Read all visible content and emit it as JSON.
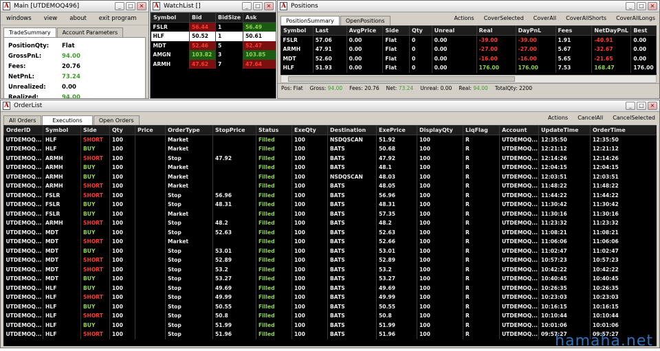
{
  "main": {
    "title": "Main [UTDEMOQ496]",
    "menu": [
      "windows",
      "view",
      "about",
      "exit program"
    ],
    "tabs": [
      "TradeSummary",
      "Account Parameters"
    ],
    "summary": [
      {
        "label": "PositionQty:",
        "value": "Flat",
        "color": "#000000"
      },
      {
        "label": "GrossPnL:",
        "value": "94.00",
        "color": "#3d9d2b"
      },
      {
        "label": "Fees:",
        "value": "20.76",
        "color": "#000000"
      },
      {
        "label": "NetPnL:",
        "value": "73.24",
        "color": "#3d9d2b"
      },
      {
        "label": "Unrealized:",
        "value": "0.00",
        "color": "#000000"
      },
      {
        "label": "Realized:",
        "value": "94.00",
        "color": "#3d9d2b"
      }
    ]
  },
  "watchlist": {
    "title": "WatchList []",
    "headers": [
      "Symbol",
      "Bid",
      "BidSize",
      "Ask"
    ],
    "rows": [
      {
        "symbol": "FSLR",
        "bid": "56.44",
        "bidsize": "1",
        "ask": "56.49",
        "bidc": "red",
        "askc": "grn"
      },
      {
        "symbol": "HLF",
        "bid": "50.52",
        "bidsize": "1",
        "ask": "50.61",
        "bidc": "",
        "askc": "",
        "selected": true
      },
      {
        "symbol": "MDT",
        "bid": "52.46",
        "bidsize": "5",
        "ask": "52.47",
        "bidc": "red",
        "askc": "red"
      },
      {
        "symbol": "AMGN",
        "bid": "103.82",
        "bidsize": "3",
        "ask": "103.85",
        "bidc": "grn",
        "askc": "grn"
      },
      {
        "symbol": "ARMH",
        "bid": "47.62",
        "bidsize": "7",
        "ask": "47.64",
        "bidc": "red",
        "askc": "red"
      }
    ]
  },
  "positions": {
    "title": "Positions",
    "tabs": [
      "PositionSummary",
      "OpenPositions"
    ],
    "actions": [
      "Actions",
      "CoverSelected",
      "CoverAll",
      "CoverAllShorts",
      "CoverAllLongs"
    ],
    "headers": [
      "Symbol",
      "Last",
      "AvgPrice",
      "Side",
      "Qty",
      "Unreal",
      "Real",
      "DayPnL",
      "Fees",
      "NetDayPnL",
      "Best"
    ],
    "rows": [
      {
        "c": [
          "FSLR",
          "57.06",
          "0.00",
          "Flat",
          "0",
          "0.00",
          "-39.00",
          "-39.00",
          "1.91",
          "-40.91",
          "0.00"
        ],
        "cls": [
          "",
          "",
          "",
          "",
          "",
          "",
          "red",
          "red",
          "",
          "red",
          ""
        ]
      },
      {
        "c": [
          "ARMH",
          "47.91",
          "0.00",
          "Flat",
          "0",
          "0.00",
          "-27.00",
          "-27.00",
          "5.67",
          "-32.67",
          "0.00"
        ],
        "cls": [
          "",
          "",
          "",
          "",
          "",
          "",
          "red",
          "red",
          "",
          "red",
          ""
        ]
      },
      {
        "c": [
          "MDT",
          "52.60",
          "0.00",
          "Flat",
          "0",
          "0.00",
          "-16.00",
          "-16.00",
          "5.65",
          "-21.65",
          "0.00"
        ],
        "cls": [
          "",
          "",
          "",
          "",
          "",
          "",
          "red",
          "red",
          "",
          "red",
          ""
        ]
      },
      {
        "c": [
          "HLF",
          "51.93",
          "0.00",
          "Flat",
          "0",
          "0.00",
          "176.00",
          "176.00",
          "7.53",
          "168.47",
          "176.00"
        ],
        "cls": [
          "",
          "",
          "",
          "",
          "",
          "",
          "grn",
          "grn",
          "",
          "grn",
          ""
        ]
      }
    ],
    "footer": [
      {
        "k": "Pos:",
        "v": "Flat",
        "c": "#000000"
      },
      {
        "k": "Gross:",
        "v": "94.00",
        "c": "#3d9d2b"
      },
      {
        "k": "Fees:",
        "v": "20.76",
        "c": "#000000"
      },
      {
        "k": "Net:",
        "v": "73.24",
        "c": "#3d9d2b"
      },
      {
        "k": "Unreal:",
        "v": "0.00",
        "c": "#000000"
      },
      {
        "k": "Real:",
        "v": "94.00",
        "c": "#3d9d2b"
      },
      {
        "k": "TotalQty:",
        "v": "2200",
        "c": "#000000"
      }
    ]
  },
  "orderlist": {
    "title": "OrderList",
    "tabs": [
      "All Orders",
      "Executions",
      "Open Orders"
    ],
    "actions": [
      "Actions",
      "CancelAll",
      "CancelSelected"
    ],
    "headers": [
      "OrderID",
      "Symbol",
      "Side",
      "Qty",
      "Price",
      "OrderType",
      "StopPrice",
      "Status",
      "ExeQty",
      "Destination",
      "ExePrice",
      "DisplayQty",
      "LiqFlag",
      "Account",
      "UpdateTime",
      "OrderTime"
    ],
    "rows": [
      [
        "UTDEMOQ...",
        "HLF",
        "SHORT",
        "100",
        "",
        "Market",
        "",
        "Filled",
        "100",
        "NSDQSCAN",
        "51.92",
        "100",
        "R",
        "UTDEMOQ...",
        "12:35:50",
        "12:35:50"
      ],
      [
        "UTDEMOQ...",
        "HLF",
        "BUY",
        "100",
        "",
        "Market",
        "",
        "Filled",
        "100",
        "BATS",
        "50.68",
        "100",
        "R",
        "UTDEMOQ...",
        "12:21:12",
        "12:21:12"
      ],
      [
        "UTDEMOQ...",
        "ARMH",
        "SHORT",
        "100",
        "",
        "Stop",
        "47.92",
        "Filled",
        "100",
        "BATS",
        "47.92",
        "100",
        "R",
        "UTDEMOQ...",
        "12:14:26",
        "12:14:26"
      ],
      [
        "UTDEMOQ...",
        "ARMH",
        "BUY",
        "100",
        "",
        "Market",
        "",
        "Filled",
        "100",
        "BATS",
        "48.1",
        "100",
        "R",
        "UTDEMOQ...",
        "12:04:15",
        "12:04:15"
      ],
      [
        "UTDEMOQ...",
        "ARMH",
        "BUY",
        "100",
        "",
        "Market",
        "",
        "Filled",
        "100",
        "NSDQSCAN",
        "48.03",
        "100",
        "R",
        "UTDEMOQ...",
        "12:03:51",
        "12:03:51"
      ],
      [
        "UTDEMOQ...",
        "ARMH",
        "SHORT",
        "100",
        "",
        "Market",
        "",
        "Filled",
        "100",
        "BATS",
        "48.05",
        "100",
        "R",
        "UTDEMOQ...",
        "11:48:22",
        "11:48:22"
      ],
      [
        "UTDEMOQ...",
        "FSLR",
        "SHORT",
        "100",
        "",
        "Stop",
        "56.96",
        "Filled",
        "100",
        "BATS",
        "56.96",
        "100",
        "R",
        "UTDEMOQ...",
        "11:44:22",
        "11:44:22"
      ],
      [
        "UTDEMOQ...",
        "FSLR",
        "BUY",
        "100",
        "",
        "Stop",
        "48.31",
        "Filled",
        "100",
        "BATS",
        "48.31",
        "100",
        "R",
        "UTDEMOQ...",
        "11:30:42",
        "11:30:42"
      ],
      [
        "UTDEMOQ...",
        "FSLR",
        "BUY",
        "100",
        "",
        "Market",
        "",
        "Filled",
        "100",
        "BATS",
        "57.35",
        "100",
        "R",
        "UTDEMOQ...",
        "11:30:16",
        "11:30:16"
      ],
      [
        "UTDEMOQ...",
        "ARMH",
        "SHORT",
        "100",
        "",
        "Stop",
        "48.2",
        "Filled",
        "100",
        "BATS",
        "48.2",
        "100",
        "R",
        "UTDEMOQ...",
        "11:23:32",
        "11:23:32"
      ],
      [
        "UTDEMOQ...",
        "MDT",
        "BUY",
        "100",
        "",
        "Stop",
        "52.63",
        "Filled",
        "100",
        "BATS",
        "52.63",
        "100",
        "R",
        "UTDEMOQ...",
        "11:08:21",
        "11:08:21"
      ],
      [
        "UTDEMOQ...",
        "MDT",
        "SHORT",
        "100",
        "",
        "Market",
        "",
        "Filled",
        "100",
        "BATS",
        "52.66",
        "100",
        "R",
        "UTDEMOQ...",
        "11:06:06",
        "11:06:06"
      ],
      [
        "UTDEMOQ...",
        "MDT",
        "BUY",
        "100",
        "",
        "Stop",
        "53.01",
        "Filled",
        "100",
        "BATS",
        "53.01",
        "100",
        "R",
        "UTDEMOQ...",
        "11:02:47",
        "11:02:47"
      ],
      [
        "UTDEMOQ...",
        "MDT",
        "SHORT",
        "100",
        "",
        "Stop",
        "52.89",
        "Filled",
        "100",
        "BATS",
        "52.89",
        "100",
        "R",
        "UTDEMOQ...",
        "10:57:23",
        "10:57:23"
      ],
      [
        "UTDEMOQ...",
        "MDT",
        "SHORT",
        "100",
        "",
        "Stop",
        "53.2",
        "Filled",
        "100",
        "BATS",
        "53.2",
        "100",
        "R",
        "UTDEMOQ...",
        "10:42:22",
        "10:42:22"
      ],
      [
        "UTDEMOQ...",
        "MDT",
        "BUY",
        "100",
        "",
        "Stop",
        "53.27",
        "Filled",
        "100",
        "BATS",
        "53.27",
        "100",
        "R",
        "UTDEMOQ...",
        "10:40:45",
        "10:40:45"
      ],
      [
        "UTDEMOQ...",
        "HLF",
        "BUY",
        "100",
        "",
        "Stop",
        "49.69",
        "Filled",
        "100",
        "BATS",
        "49.69",
        "100",
        "R",
        "UTDEMOQ...",
        "10:26:35",
        "10:26:35"
      ],
      [
        "UTDEMOQ...",
        "HLF",
        "SHORT",
        "100",
        "",
        "Stop",
        "49.99",
        "Filled",
        "100",
        "BATS",
        "49.99",
        "100",
        "R",
        "UTDEMOQ...",
        "10:23:03",
        "10:23:03"
      ],
      [
        "UTDEMOQ...",
        "HLF",
        "BUY",
        "100",
        "",
        "Stop",
        "50.55",
        "Filled",
        "100",
        "BATS",
        "50.55",
        "100",
        "R",
        "UTDEMOQ...",
        "10:16:15",
        "10:16:15"
      ],
      [
        "UTDEMOQ...",
        "HLF",
        "SHORT",
        "100",
        "",
        "Stop",
        "50.8",
        "Filled",
        "100",
        "BATS",
        "50.8",
        "100",
        "R",
        "UTDEMOQ...",
        "10:10:44",
        "10:10:44"
      ],
      [
        "UTDEMOQ...",
        "HLF",
        "BUY",
        "100",
        "",
        "Stop",
        "51.99",
        "Filled",
        "100",
        "BATS",
        "51.99",
        "100",
        "R",
        "UTDEMOQ...",
        "10:01:06",
        "10:01:06"
      ],
      [
        "UTDEMOQ...",
        "HLF",
        "SHORT",
        "100",
        "",
        "Stop",
        "51.96",
        "Filled",
        "100",
        "BATS",
        "51.96",
        "100",
        "R",
        "UTDEMOQ...",
        "09:57:27",
        "09:57:27"
      ]
    ]
  },
  "watermark": "hamaha.net",
  "colors": {
    "sell": "#ff3b30",
    "buy": "#8fd44a",
    "grid_bg": "#000000",
    "chrome": "#d4d0c8"
  }
}
